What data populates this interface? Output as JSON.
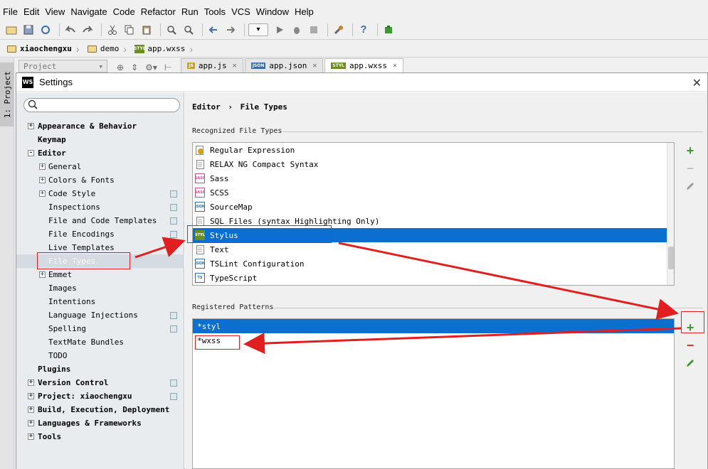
{
  "menubar": [
    "File",
    "Edit",
    "View",
    "Navigate",
    "Code",
    "Refactor",
    "Run",
    "Tools",
    "VCS",
    "Window",
    "Help"
  ],
  "breadcrumb": {
    "items": [
      "xiaochengxu",
      "demo",
      "app.wxss"
    ]
  },
  "project_panel": {
    "dropdown_label": "Project",
    "stripe_label": "1: Project"
  },
  "editor_tabs": [
    {
      "label": "app.js",
      "icon": "JS"
    },
    {
      "label": "app.json",
      "icon": "JSON"
    },
    {
      "label": "app.wxss",
      "icon": "STYL",
      "active": true
    }
  ],
  "dialog": {
    "title": "Settings",
    "icon_text": "WS"
  },
  "tree": [
    {
      "label": "Appearance & Behavior",
      "level": 0,
      "bold": true,
      "expand": "+"
    },
    {
      "label": "Keymap",
      "level": 0,
      "bold": true
    },
    {
      "label": "Editor",
      "level": 0,
      "bold": true,
      "expand": "-"
    },
    {
      "label": "General",
      "level": 1,
      "expand": "+"
    },
    {
      "label": "Colors & Fonts",
      "level": 1,
      "expand": "+"
    },
    {
      "label": "Code Style",
      "level": 1,
      "expand": "+",
      "cfg": true
    },
    {
      "label": "Inspections",
      "level": 2,
      "cfg": true
    },
    {
      "label": "File and Code Templates",
      "level": 2,
      "cfg": true
    },
    {
      "label": "File Encodings",
      "level": 2,
      "cfg": true
    },
    {
      "label": "Live Templates",
      "level": 2
    },
    {
      "label": "File Types",
      "level": 2,
      "selected": true
    },
    {
      "label": "Emmet",
      "level": 1,
      "expand": "+"
    },
    {
      "label": "Images",
      "level": 2
    },
    {
      "label": "Intentions",
      "level": 2
    },
    {
      "label": "Language Injections",
      "level": 2,
      "cfg": true
    },
    {
      "label": "Spelling",
      "level": 2,
      "cfg": true
    },
    {
      "label": "TextMate Bundles",
      "level": 2
    },
    {
      "label": "TODO",
      "level": 2
    },
    {
      "label": "Plugins",
      "level": 0,
      "bold": true
    },
    {
      "label": "Version Control",
      "level": 0,
      "bold": true,
      "expand": "+",
      "cfg": true
    },
    {
      "label": "Project: xiaochengxu",
      "level": 0,
      "bold": true,
      "expand": "+",
      "cfg": true
    },
    {
      "label": "Build, Execution, Deployment",
      "level": 0,
      "bold": true,
      "expand": "+"
    },
    {
      "label": "Languages & Frameworks",
      "level": 0,
      "bold": true,
      "expand": "+"
    },
    {
      "label": "Tools",
      "level": 0,
      "bold": true,
      "expand": "+"
    }
  ],
  "content": {
    "crumb_parent": "Editor",
    "crumb_sep": "›",
    "crumb_current": "File Types",
    "recognized_label": "Recognized File Types",
    "registered_label": "Registered Patterns"
  },
  "file_types": [
    {
      "label": "Regular Expression",
      "icon": "regex",
      "color": "#d4a017"
    },
    {
      "label": "RELAX NG Compact Syntax",
      "icon": "doc",
      "color": "#888888"
    },
    {
      "label": "Sass",
      "icon": "SASS",
      "color": "#c6538c"
    },
    {
      "label": "SCSS",
      "icon": "SASS",
      "color": "#c6538c"
    },
    {
      "label": "SourceMap",
      "icon": "JSON",
      "color": "#3a6ea5"
    },
    {
      "label": "SQL Files (syntax Highlighting Only)",
      "icon": "doc",
      "color": "#888888"
    },
    {
      "label": "Stylus",
      "icon": "STYL",
      "color": "#6b8e23",
      "selected": true
    },
    {
      "label": "Text",
      "icon": "doc",
      "color": "#888888"
    },
    {
      "label": "TSLint Configuration",
      "icon": "JSON",
      "color": "#3a6ea5"
    },
    {
      "label": "TypeScript",
      "icon": "TS",
      "color": "#3a6ea5"
    }
  ],
  "patterns": [
    {
      "label": "*styl",
      "selected": true
    },
    {
      "label": "*wxss"
    }
  ],
  "colors": {
    "selection": "#0a6fd0",
    "annotation": "#e02020",
    "add_green": "#3b9a2e"
  }
}
